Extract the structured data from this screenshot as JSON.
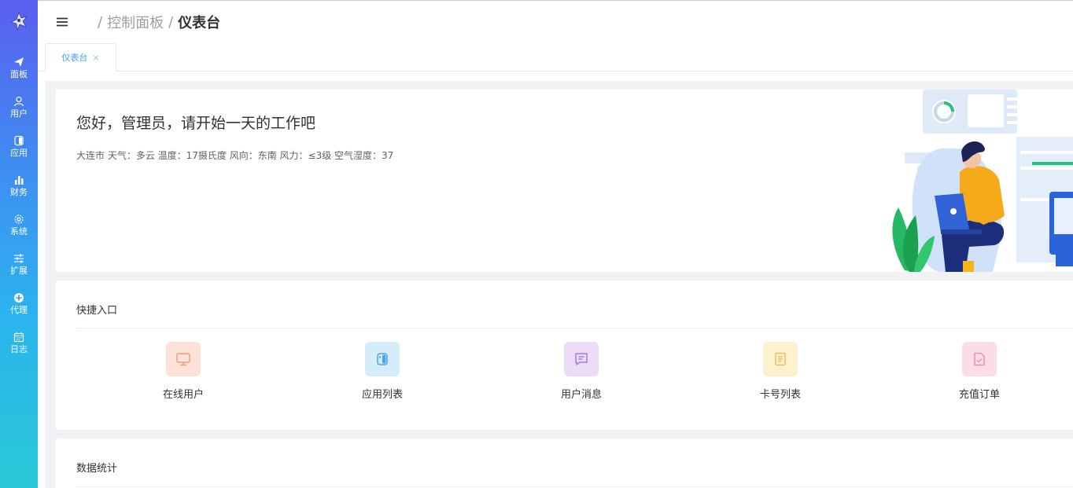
{
  "sidebar": {
    "logo": "logo-bird-icon",
    "items": [
      {
        "label": "面板",
        "icon": "paper-plane-icon"
      },
      {
        "label": "用户",
        "icon": "user-icon"
      },
      {
        "label": "应用",
        "icon": "switch-icon"
      },
      {
        "label": "财务",
        "icon": "bar-chart-icon"
      },
      {
        "label": "系统",
        "icon": "gear-icon"
      },
      {
        "label": "扩展",
        "icon": "sliders-icon"
      },
      {
        "label": "代理",
        "icon": "plus-circle-icon"
      },
      {
        "label": "日志",
        "icon": "calendar-icon"
      }
    ]
  },
  "header": {
    "breadcrumb": [
      "控制面板",
      "仪表台"
    ]
  },
  "tabs": [
    {
      "label": "仪表台",
      "close": "×"
    }
  ],
  "welcome": {
    "title": "您好，管理员，请开始一天的工作吧",
    "weather": "大连市 天气：多云 温度：17摄氏度 风向：东南 风力：≤3级 空气湿度：37"
  },
  "quick_entry": {
    "title": "快捷入口",
    "items": [
      {
        "label": "在线用户",
        "icon": "monitor-icon",
        "bg": "#fde3d7",
        "fg": "#f29e7c"
      },
      {
        "label": "应用列表",
        "icon": "switch-icon",
        "bg": "#d5ecfb",
        "fg": "#4aa3e8"
      },
      {
        "label": "用户消息",
        "icon": "message-icon",
        "bg": "#ecdcf7",
        "fg": "#a77bd6"
      },
      {
        "label": "卡号列表",
        "icon": "document-icon",
        "bg": "#fdf1cf",
        "fg": "#e6c160"
      },
      {
        "label": "充值订单",
        "icon": "order-icon",
        "bg": "#fbdde8",
        "fg": "#ec8db0"
      }
    ]
  },
  "stats": {
    "title": "数据统计"
  },
  "colors": {
    "accent": "#409eff",
    "sidebar_top": "#5a5fef",
    "sidebar_bottom": "#29c8d6"
  }
}
